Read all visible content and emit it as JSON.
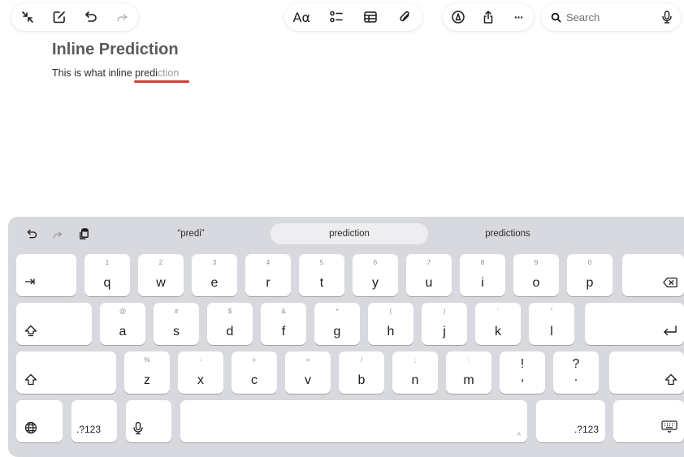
{
  "toolbar": {
    "left_icons": [
      "collapse-icon",
      "compose-icon",
      "undo-icon",
      "redo-icon"
    ],
    "center_icons": [
      "text-format-icon",
      "checklist-icon",
      "table-icon",
      "attachment-icon"
    ],
    "format_label": "Aα",
    "right_icons": [
      "markup-icon",
      "share-icon",
      "more-icon"
    ],
    "more_label": "···",
    "search_placeholder": "Search"
  },
  "note": {
    "title": "Inline Prediction",
    "body_typed": "This is what inline predi",
    "body_prediction": "ction"
  },
  "keyboard": {
    "suggestions": [
      "“predi”",
      "prediction",
      "predictions"
    ],
    "rows": {
      "row1": {
        "tab": "⇥",
        "keys": [
          {
            "main": "q",
            "alt": "1"
          },
          {
            "main": "w",
            "alt": "2"
          },
          {
            "main": "e",
            "alt": "3"
          },
          {
            "main": "r",
            "alt": "4"
          },
          {
            "main": "t",
            "alt": "5"
          },
          {
            "main": "y",
            "alt": "6"
          },
          {
            "main": "u",
            "alt": "7"
          },
          {
            "main": "i",
            "alt": "8"
          },
          {
            "main": "o",
            "alt": "9"
          },
          {
            "main": "p",
            "alt": "0"
          }
        ],
        "delete": "⌫"
      },
      "row2": {
        "caps": "⇪",
        "keys": [
          {
            "main": "a",
            "alt": "@"
          },
          {
            "main": "s",
            "alt": "#"
          },
          {
            "main": "d",
            "alt": "$"
          },
          {
            "main": "f",
            "alt": "&"
          },
          {
            "main": "g",
            "alt": "*"
          },
          {
            "main": "h",
            "alt": "("
          },
          {
            "main": "j",
            "alt": ")"
          },
          {
            "main": "k",
            "alt": "’"
          },
          {
            "main": "l",
            "alt": "”"
          }
        ],
        "return": "⏎"
      },
      "row3": {
        "shift": "⇧",
        "keys": [
          {
            "main": "z",
            "alt": "%"
          },
          {
            "main": "x",
            "alt": "-"
          },
          {
            "main": "c",
            "alt": "+"
          },
          {
            "main": "v",
            "alt": "="
          },
          {
            "main": "b",
            "alt": "/"
          },
          {
            "main": "n",
            "alt": ";"
          },
          {
            "main": "m",
            "alt": ":"
          }
        ],
        "punct": [
          {
            "top": "!",
            "bottom": ","
          },
          {
            "top": "?",
            "bottom": "."
          }
        ]
      },
      "row4": {
        "numbers_left": ".?123",
        "numbers_right": ".?123",
        "space_hint": "A"
      }
    }
  },
  "colors": {
    "keyboard_bg": "#d7d9de",
    "key_bg": "#ffffff",
    "prediction_text": "#9a9aa0",
    "underline": "#d83a3a"
  }
}
